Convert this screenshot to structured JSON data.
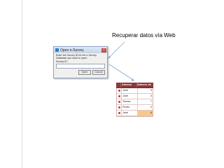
{
  "caption": "Recuperar datos vía Web",
  "dialog": {
    "title": "Open e-Survey",
    "message": "Enter the Survey ID for the e-Survey Database you want to open:",
    "label": "Survey ID:",
    "input_value": "",
    "open_label": "Open",
    "cancel_label": "Cancel",
    "close_glyph": "×"
  },
  "table": {
    "headers": [
      "Alumno",
      "Número de créditos"
    ],
    "rows": [
      {
        "name": "José",
        "value": "9"
      },
      {
        "name": "Juan",
        "value": "3"
      },
      {
        "name": "Teresa",
        "value": "7"
      },
      {
        "name": "Pedro",
        "value": "0"
      },
      {
        "name": "José",
        "value": "6"
      }
    ]
  },
  "colors": {
    "table_header": "#8b3a3a",
    "highlight_cell": "#f6c98a",
    "arrow": "#7fa7c9"
  }
}
